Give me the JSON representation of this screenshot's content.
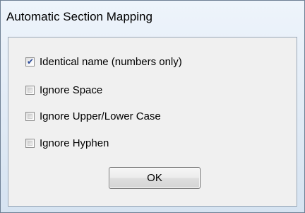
{
  "dialog": {
    "title": "Automatic Section Mapping"
  },
  "options": [
    {
      "label": "Identical name (numbers only)",
      "checked": true
    },
    {
      "label": "Ignore Space",
      "checked": false
    },
    {
      "label": "Ignore Upper/Lower Case",
      "checked": false
    },
    {
      "label": "Ignore Hyphen",
      "checked": false
    }
  ],
  "buttons": {
    "ok_label": "OK"
  },
  "icons": {
    "check": "check-icon"
  },
  "colors": {
    "checkmark": "#2b4b9b"
  }
}
